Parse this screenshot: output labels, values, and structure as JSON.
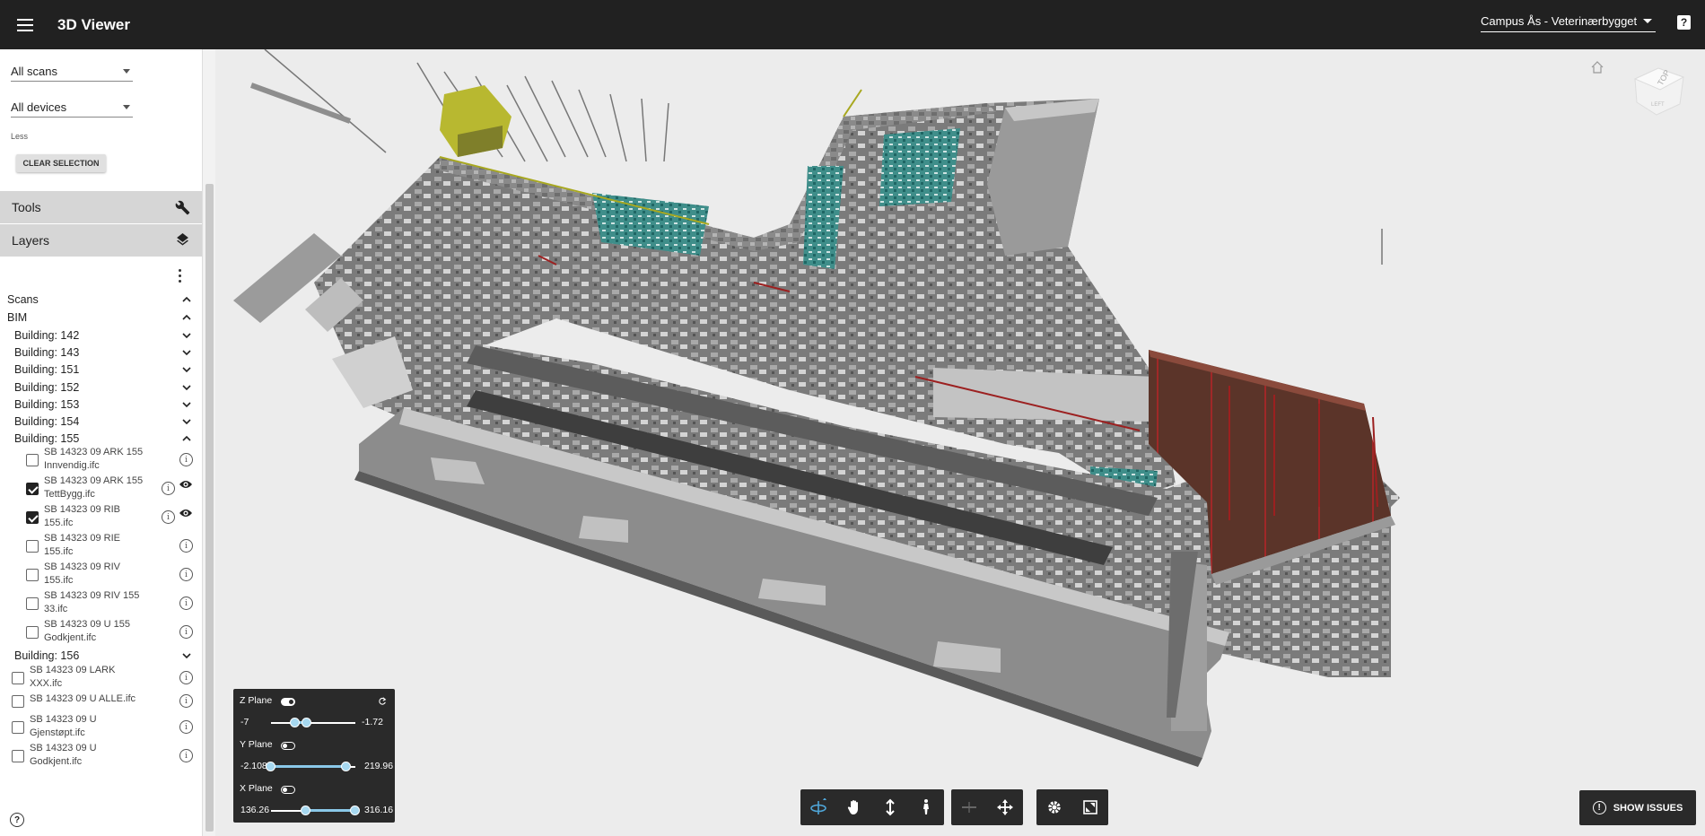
{
  "app": {
    "title": "3D Viewer",
    "project": "Campus Ås - Veterinærbygget",
    "help": "?"
  },
  "filters": {
    "scans": "All scans",
    "devices": "All devices",
    "less": "Less",
    "clear": "CLEAR SELECTION"
  },
  "panels": {
    "tools": "Tools",
    "layers": "Layers"
  },
  "tree": {
    "scans": "Scans",
    "bim": "BIM",
    "buildings": [
      {
        "label": "Building: 142"
      },
      {
        "label": "Building: 143"
      },
      {
        "label": "Building: 151"
      },
      {
        "label": "Building: 152"
      },
      {
        "label": "Building: 153"
      },
      {
        "label": "Building: 154"
      },
      {
        "label": "Building: 155"
      }
    ],
    "b155_files": [
      {
        "l1": "SB 14323 09 ARK 155",
        "l2": "Innvendig.ifc",
        "checked": false,
        "visible": false
      },
      {
        "l1": "SB 14323 09 ARK 155",
        "l2": "TettBygg.ifc",
        "checked": true,
        "visible": true
      },
      {
        "l1": "SB 14323 09 RIB",
        "l2": "155.ifc",
        "checked": true,
        "visible": true
      },
      {
        "l1": "SB 14323 09 RIE",
        "l2": "155.ifc",
        "checked": false,
        "visible": false
      },
      {
        "l1": "SB 14323 09 RIV",
        "l2": "155.ifc",
        "checked": false,
        "visible": false
      },
      {
        "l1": "SB 14323 09 RIV 155",
        "l2": "33.ifc",
        "checked": false,
        "visible": false
      },
      {
        "l1": "SB 14323 09 U 155",
        "l2": "Godkjent.ifc",
        "checked": false,
        "visible": false
      }
    ],
    "building156": "Building: 156",
    "b156_files": [
      {
        "l1": "SB 14323 09 LARK",
        "l2": "XXX.ifc"
      },
      {
        "l1": "SB 14323 09 U ALLE.ifc",
        "l2": ""
      },
      {
        "l1": "SB 14323 09 U",
        "l2": "Gjenstøpt.ifc"
      },
      {
        "l1": "SB 14323 09 U",
        "l2": "Godkjent.ifc"
      }
    ]
  },
  "clipping": {
    "z": {
      "label": "Z Plane",
      "min": "-7",
      "max": "-1.72",
      "enabled": true
    },
    "y": {
      "label": "Y Plane",
      "min": "-2.108",
      "max": "219.96",
      "enabled": false
    },
    "x": {
      "label": "X Plane",
      "min": "136.26",
      "max": "316.16",
      "enabled": false
    }
  },
  "issues": {
    "label": "SHOW ISSUES"
  },
  "colors": {
    "topbar": "#212121",
    "panel": "#d6d6d6",
    "accent": "#4fa6d8",
    "teal": "#2e8a88",
    "brick": "#5a3328"
  },
  "icons": [
    "menu-icon",
    "wrench-icon",
    "layers-icon",
    "info-icon",
    "eye-icon",
    "orbit-icon",
    "pan-icon",
    "updown-icon",
    "walk-icon",
    "section-icon",
    "move-icon",
    "settings-icon",
    "fullscreen-icon",
    "home-icon"
  ]
}
